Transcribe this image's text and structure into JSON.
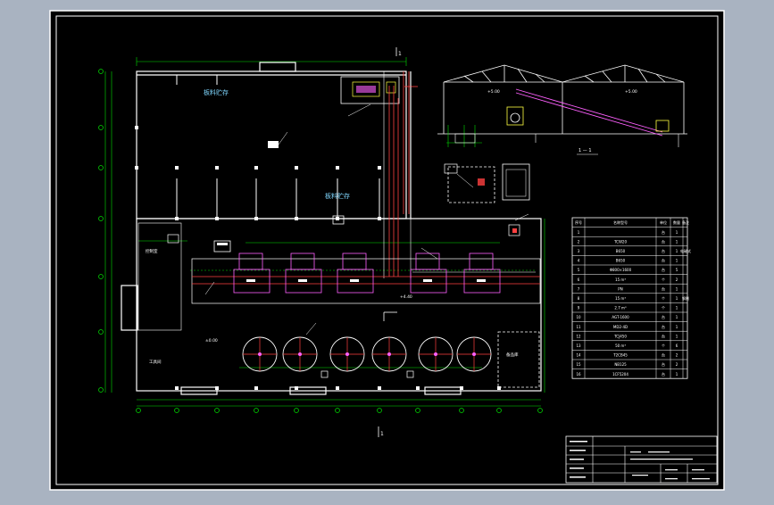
{
  "colors": {
    "viewport_bg": "#a9b3c1",
    "sheet": "#000000",
    "frame": "#ffffff",
    "dim": "#00e000",
    "wall": "#ffffff",
    "pipe": "#ff4040",
    "label": "#7fd7ff",
    "equip": "#ff60ff",
    "accent": "#ffff40"
  },
  "plan": {
    "storage_label_top": "板料贮存",
    "storage_label_mid": "板料贮存",
    "office_label": "控制室",
    "tool_room_label": "工具间",
    "spare_room_label": "备品库",
    "elevation_mark": "±0.00",
    "elevation_mark_2": "+4.40",
    "section_top": "1",
    "section_bottom": "1"
  },
  "section_view": {
    "caption": "1 — 1",
    "height_mark": "+5.00",
    "height_mark_left": "+5.00"
  },
  "equipment_table": {
    "headers": [
      "序号",
      "名称型号",
      "单位",
      "数量",
      "备注"
    ],
    "rows": [
      [
        "1",
        "",
        "台",
        "1",
        ""
      ],
      [
        "2",
        "TCW20",
        "台",
        "1",
        ""
      ],
      [
        "3",
        "B650",
        "台",
        "1",
        "电磁式"
      ],
      [
        "4",
        "B650",
        "台",
        "1",
        ""
      ],
      [
        "5",
        "Φ800×1600",
        "台",
        "5",
        ""
      ],
      [
        "6",
        "15 m³",
        "个",
        "2",
        ""
      ],
      [
        "7",
        "PN",
        "台",
        "1",
        ""
      ],
      [
        "8",
        "15 m³",
        "个",
        "1",
        "钢制"
      ],
      [
        "9",
        "2.7 m³",
        "个",
        "1",
        ""
      ],
      [
        "10",
        "AGT-1600",
        "台",
        "1",
        ""
      ],
      [
        "11",
        "MD2-4D",
        "台",
        "1",
        ""
      ],
      [
        "12",
        "TCJ450",
        "台",
        "1",
        ""
      ],
      [
        "13",
        "50 m³",
        "个",
        "6",
        ""
      ],
      [
        "14",
        "T2CB45",
        "台",
        "2",
        ""
      ],
      [
        "15",
        "NB125",
        "台",
        "2",
        ""
      ],
      [
        "16",
        "1CF5204",
        "台",
        "1",
        ""
      ]
    ]
  },
  "title_block": {
    "row1": "",
    "drawing_no": "",
    "scale": "",
    "sheet": ""
  }
}
